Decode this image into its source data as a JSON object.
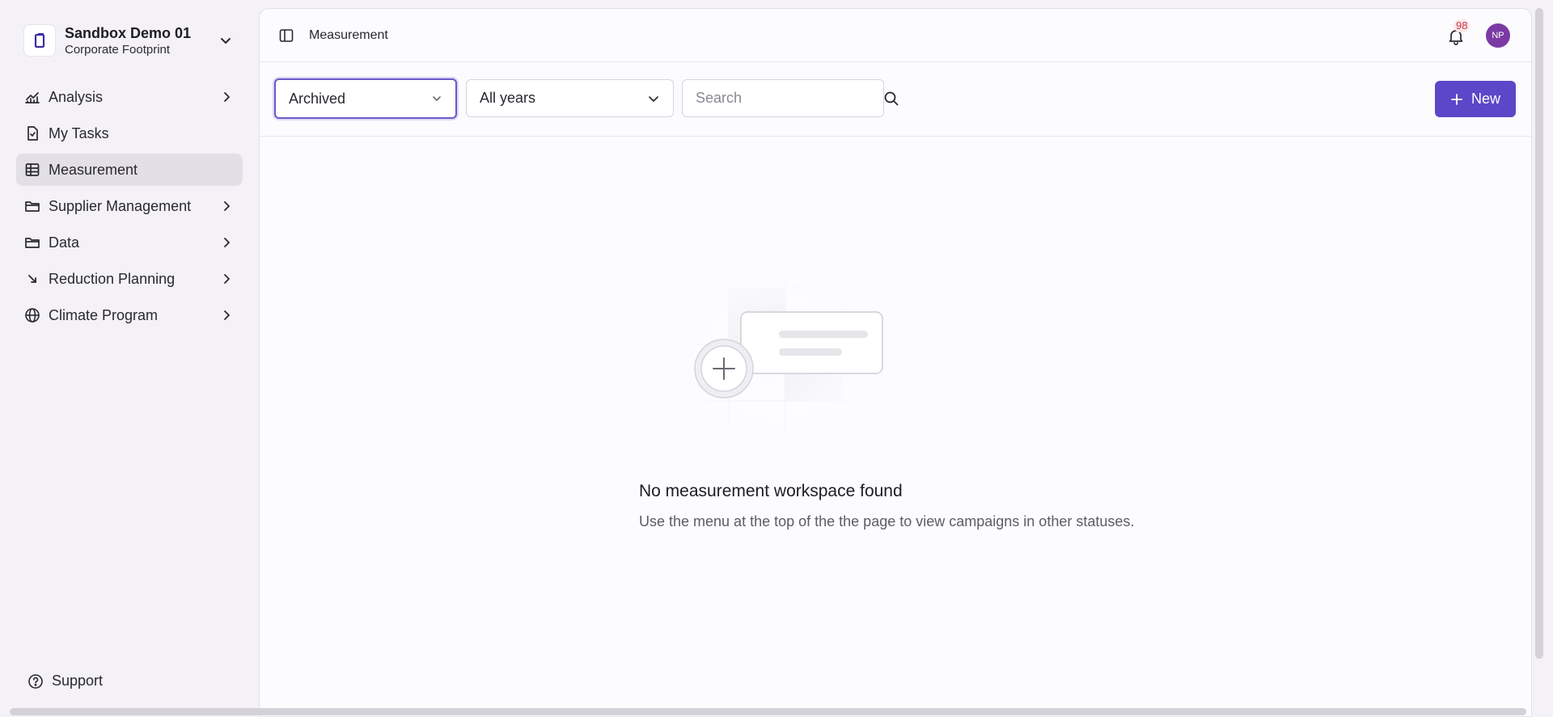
{
  "org": {
    "name": "Sandbox Demo 01",
    "subtitle": "Corporate Footprint"
  },
  "sidebar": {
    "items": [
      {
        "label": "Analysis",
        "icon": "chart-icon",
        "has_children": true
      },
      {
        "label": "My Tasks",
        "icon": "task-file-icon",
        "has_children": false
      },
      {
        "label": "Measurement",
        "icon": "table-grid-icon",
        "has_children": false,
        "active": true
      },
      {
        "label": "Supplier Management",
        "icon": "folder-icon",
        "has_children": true
      },
      {
        "label": "Data",
        "icon": "folder-icon",
        "has_children": true
      },
      {
        "label": "Reduction Planning",
        "icon": "arrow-down-right-icon",
        "has_children": true
      },
      {
        "label": "Climate Program",
        "icon": "globe-icon",
        "has_children": true
      }
    ],
    "support_label": "Support"
  },
  "header": {
    "breadcrumb": "Measurement",
    "notification_count": "98",
    "avatar_initials": "NP"
  },
  "filters": {
    "status_value": "Archived",
    "year_value": "All years",
    "search_placeholder": "Search",
    "new_button_label": "New"
  },
  "empty_state": {
    "title": "No measurement workspace found",
    "description": "Use the menu at the top of the the page to view campaigns in other statuses."
  },
  "colors": {
    "accent": "#5b47c8",
    "active_nav_bg": "#e2dfe7",
    "avatar_bg": "#7b3aa3",
    "badge_text": "#c53a4b"
  }
}
